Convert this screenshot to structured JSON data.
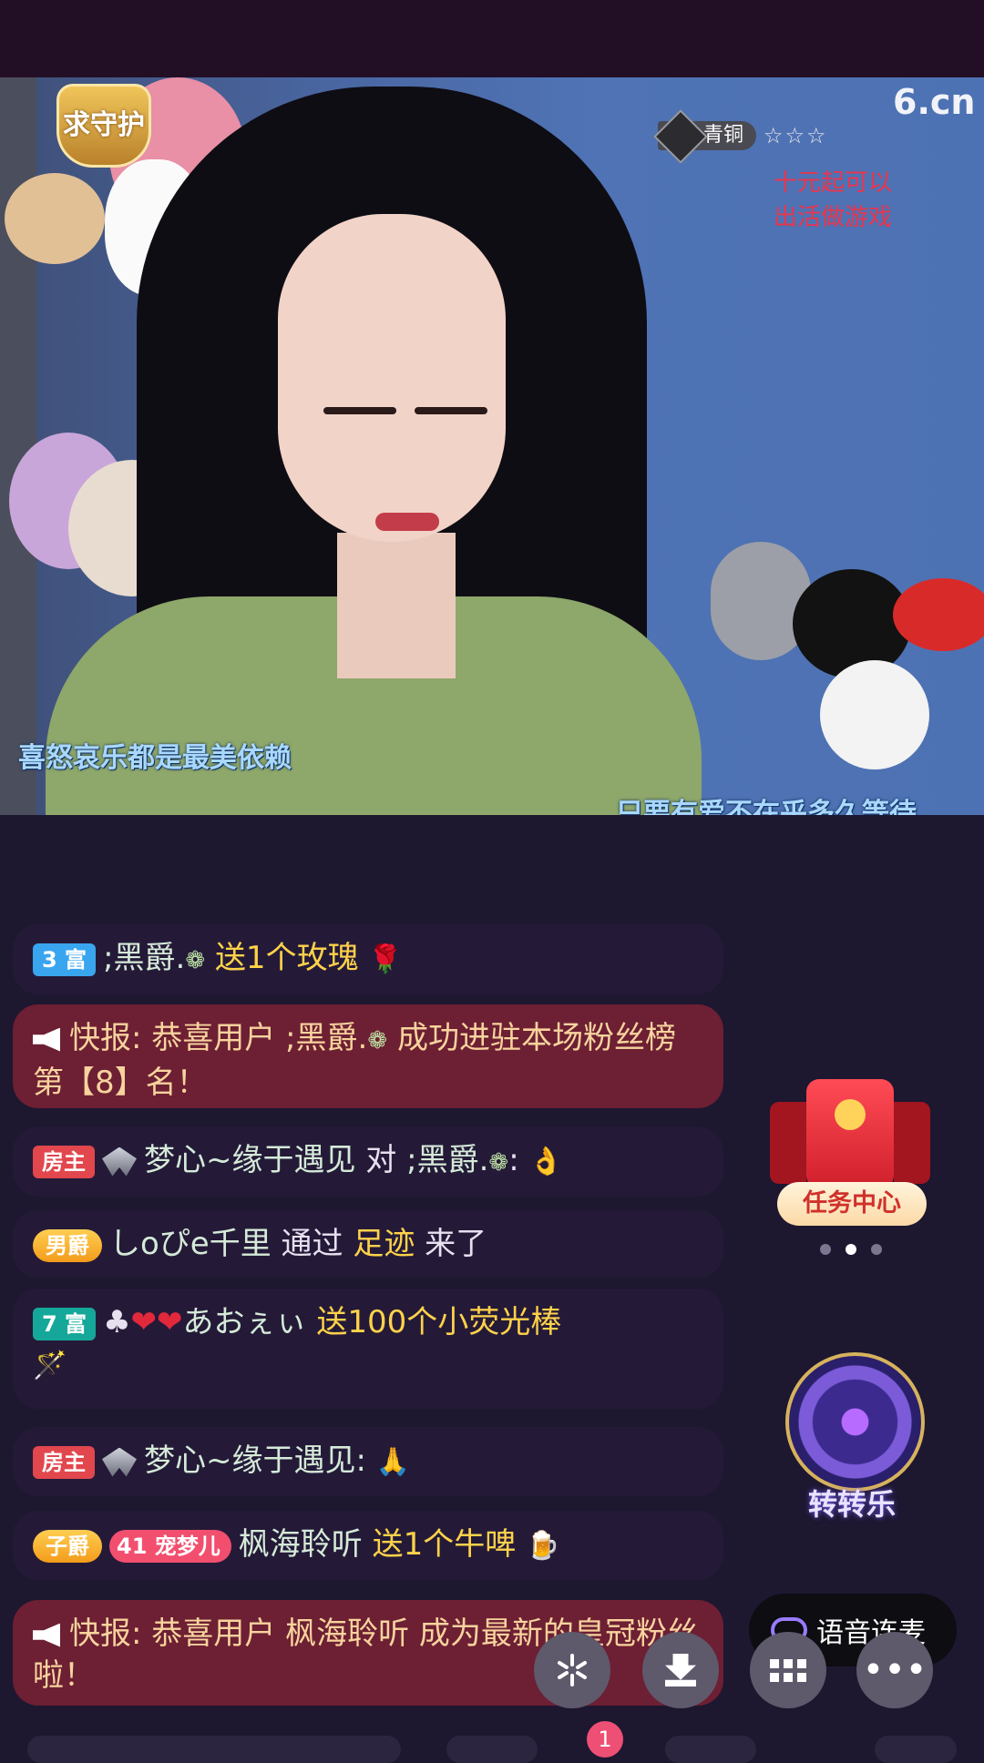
{
  "video": {
    "guard_badge": "求守护",
    "rank_label": "青铜",
    "rank_stars": "☆☆☆",
    "watermark": "6.cn",
    "sign_text_line1": "十元起可以",
    "sign_text_line2": "出活做游戏",
    "lyric_left": "喜怒哀乐都是最美依赖",
    "lyric_right": "只要有爱不在乎多久等待"
  },
  "chat": {
    "m1": {
      "badge": "3 富",
      "user": ";黑爵.",
      "action": "送1个玫瑰",
      "emoji": "🌹"
    },
    "m2": {
      "text": "快报: 恭喜用户 ;黑爵.",
      "text2": " 成功进驻本场粉丝榜第【8】名！"
    },
    "m3": {
      "badge": "房主",
      "user": "梦心~缘于遇见",
      "mid": " 对 ",
      "target": ";黑爵.",
      "tail": ": ",
      "emoji": "👌"
    },
    "m4": {
      "badge": "男爵",
      "user": "しoぴe千里",
      "mid": " 通过 ",
      "gold": "足迹",
      "tail": " 来了"
    },
    "m5": {
      "badge": "7 富",
      "user": "あおぇぃ",
      "action": "送100个小荧光棒",
      "emoji": "🪄"
    },
    "m6": {
      "badge": "房主",
      "user": "梦心~缘于遇见:",
      "emoji": "🙏"
    },
    "m7": {
      "badge": "子爵",
      "pet_badge": "宠梦儿",
      "pet_level": "41",
      "user": "枫海聆听",
      "action": "送1个牛啤",
      "emoji": "🍺"
    },
    "m8": {
      "text": "快报: 恭喜用户 枫海聆听 成为最新的皇冠粉丝啦！"
    }
  },
  "side": {
    "task_center": "任务中心",
    "spin_label": "转转乐",
    "voice_link": "语音连麦",
    "notif_count": "1"
  },
  "icons": {
    "share": "share-burst-icon",
    "download": "download-icon",
    "apps": "apps-grid-icon",
    "more": "more-dots-icon"
  }
}
